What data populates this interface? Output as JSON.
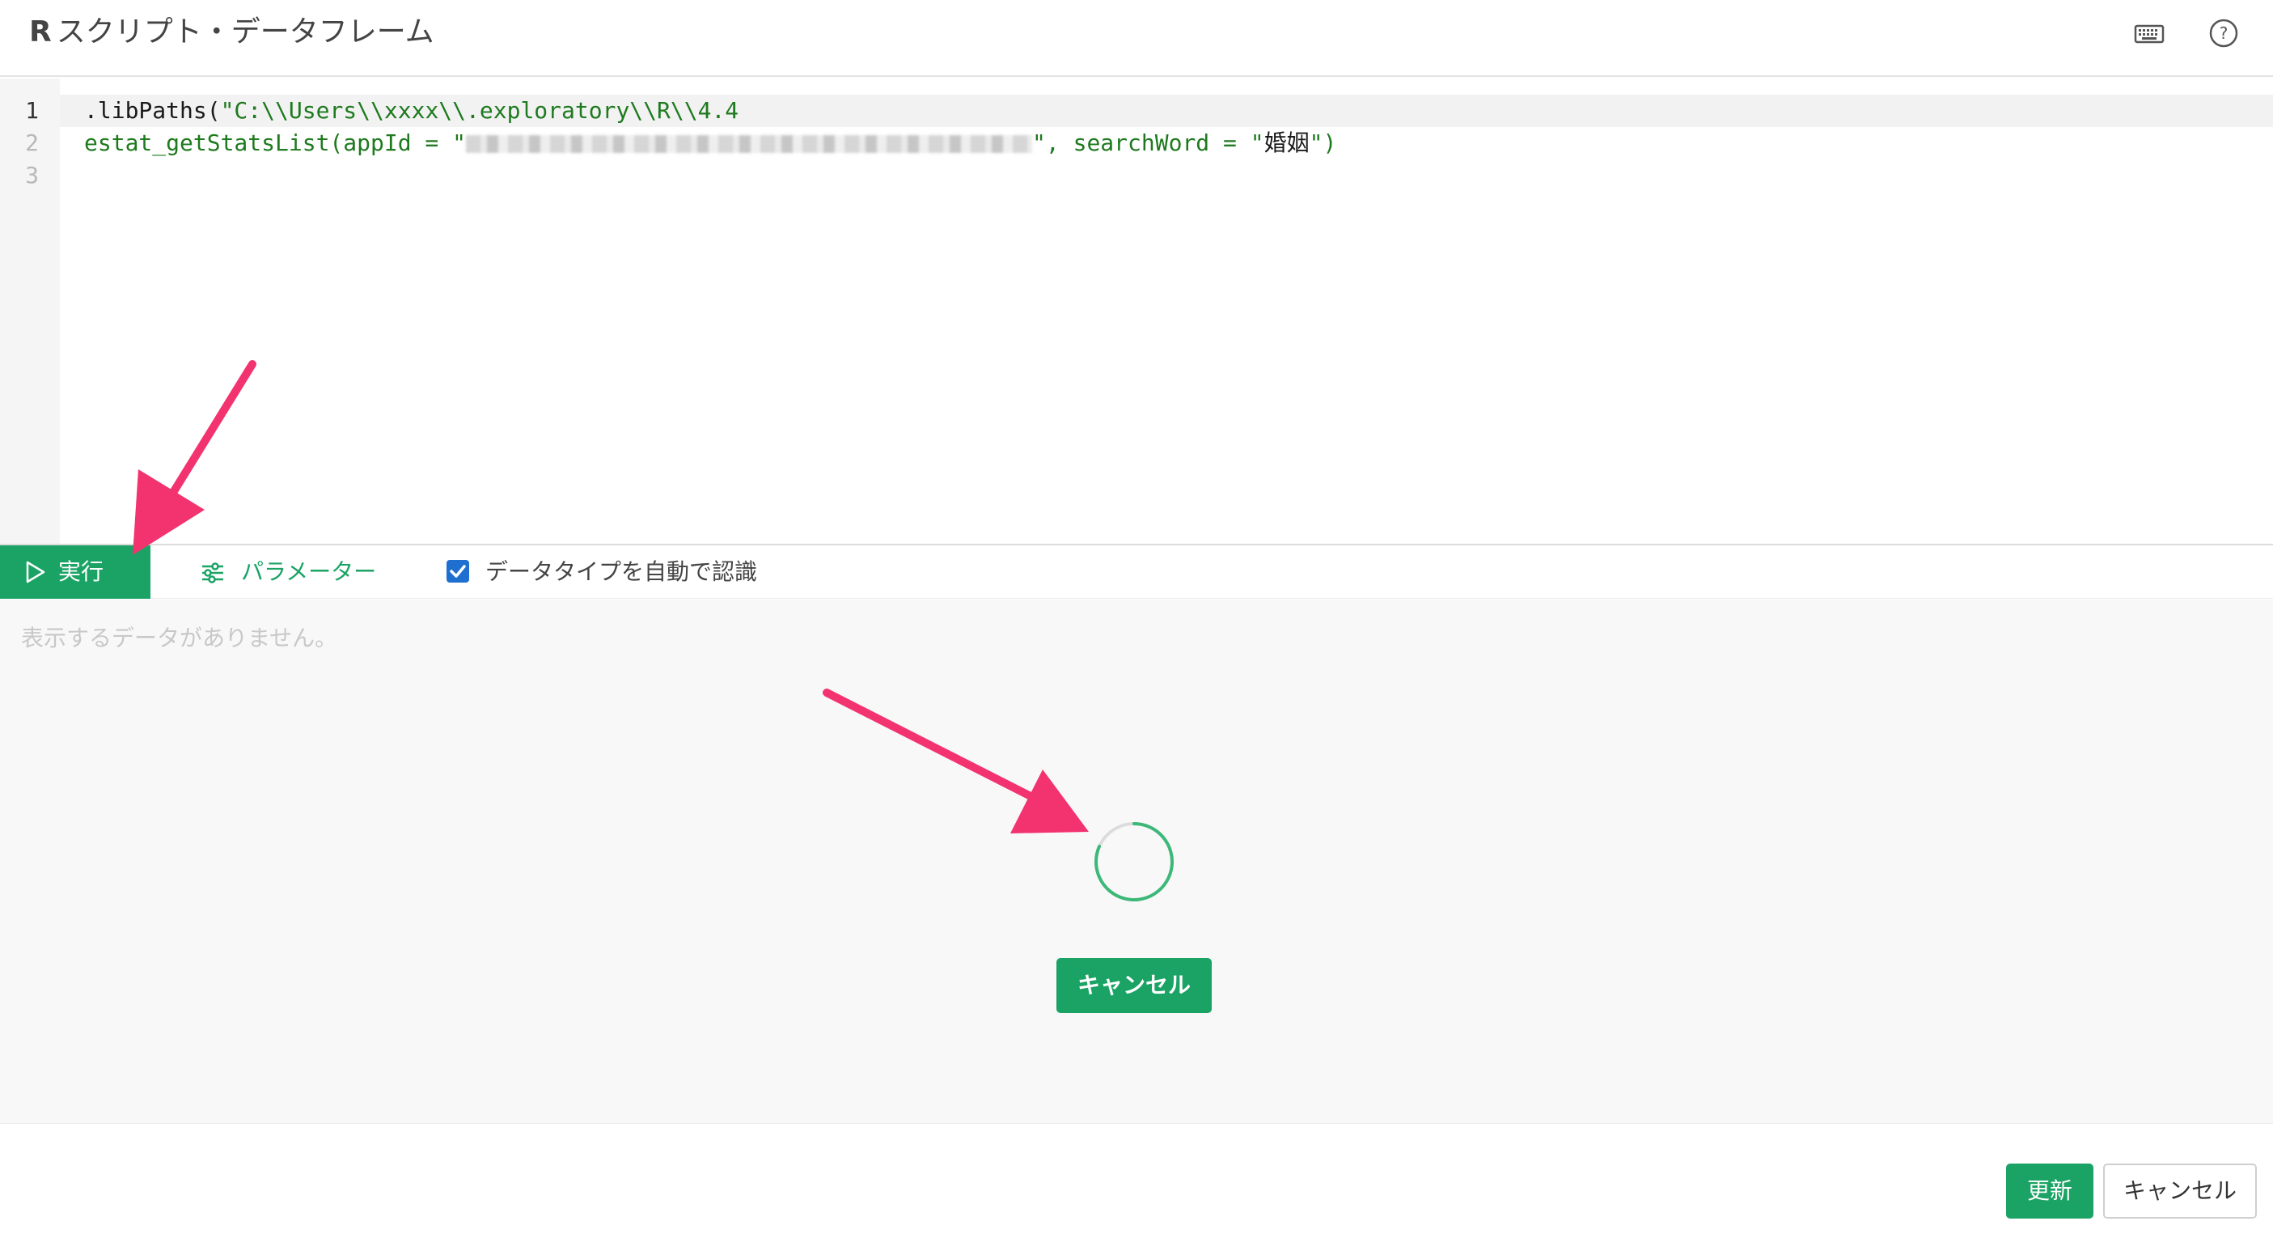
{
  "header": {
    "title_r": "R",
    "title_text": "スクリプト・データフレーム",
    "icons": [
      "keyboard-icon",
      "help-icon"
    ]
  },
  "editor": {
    "line_numbers": [
      "1",
      "2",
      "3"
    ],
    "lines": [
      {
        "fn": ".libPaths",
        "open": "(",
        "str": "\"C:\\\\Users\\\\xxxx\\\\.exploratory\\\\R\\\\4.4"
      },
      {
        "prefix": "estat_getStatsList(appId = \"",
        "suffix": "\", searchWord = \"",
        "word": "婚姻",
        "end": "\")"
      },
      {}
    ]
  },
  "toolbar": {
    "run_label": "実行",
    "params_label": "パラメーター",
    "auto_type_label": "データタイプを自動で認識",
    "auto_type_checked": true
  },
  "result": {
    "empty_message": "表示するデータがありません。",
    "cancel_label": "キャンセル"
  },
  "footer": {
    "update_label": "更新",
    "cancel_label": "キャンセル"
  },
  "colors": {
    "accent_green": "#1aa364",
    "annotation_pink": "#f2336f",
    "checkbox_blue": "#1f6fd1"
  }
}
